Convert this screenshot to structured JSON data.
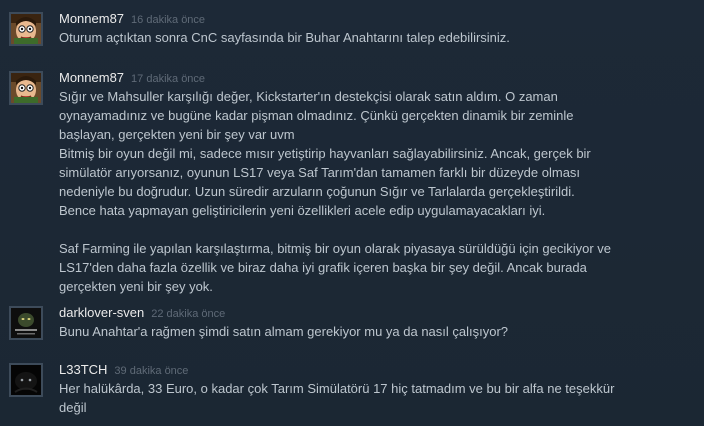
{
  "comments": [
    {
      "author": "Monnem87",
      "time": "16 dakika önce",
      "avatar_icon": "cartoon-face-avatar",
      "lines": [
        "Oturum açtıktan sonra CnC sayfasında bir Buhar Anahtarını talep edebilirsiniz."
      ]
    },
    {
      "author": "Monnem87",
      "time": "17 dakika önce",
      "avatar_icon": "cartoon-face-avatar",
      "lines": [
        "Sığır ve Mahsuller karşılığı değer, Kickstarter'ın destekçisi olarak satın aldım. O zaman",
        "oynayamadınız ve bugüne kadar pişman olmadınız. Çünkü gerçekten dinamik bir zeminle",
        "başlayan, gerçekten yeni bir şey var uvm",
        "Bitmiş bir oyun değil mi, sadece mısır yetiştirip hayvanları sağlayabilirsiniz. Ancak, gerçek bir",
        "simülatör arıyorsanız, oyunun LS17 veya Saf Tarım'dan tamamen farklı bir düzeyde olması",
        "nedeniyle bu doğrudur. Uzun süredir arzuların çoğunun Sığır ve Tarlalarda gerçekleştirildi.",
        "Bence hata yapmayan geliştiricilerin yeni özellikleri acele edip uygulamayacakları iyi.",
        "",
        "Saf Farming ile yapılan karşılaştırma, bitmiş bir oyun olarak piyasaya sürüldüğü için gecikiyor ve",
        "LS17'den daha fazla özellik ve biraz daha iyi grafik içeren başka bir şey değil. Ancak burada",
        "gerçekten yeni bir şey yok."
      ]
    },
    {
      "author": "darklover-sven",
      "time": "22 dakika önce",
      "avatar_icon": "dark-poster-avatar",
      "lines": [
        "Bunu Anahtar'a rağmen şimdi satın almam gerekiyor mu ya da nasıl çalışıyor?"
      ]
    },
    {
      "author": "L33TCH",
      "time": "39 dakika önce",
      "avatar_icon": "black-creature-avatar",
      "lines": [
        "Her halükârda, 33 Euro, o kadar çok Tarım Simülatörü 17 hiç tatmadım ve bu bir alfa ne teşekkür",
        "değil"
      ]
    }
  ]
}
